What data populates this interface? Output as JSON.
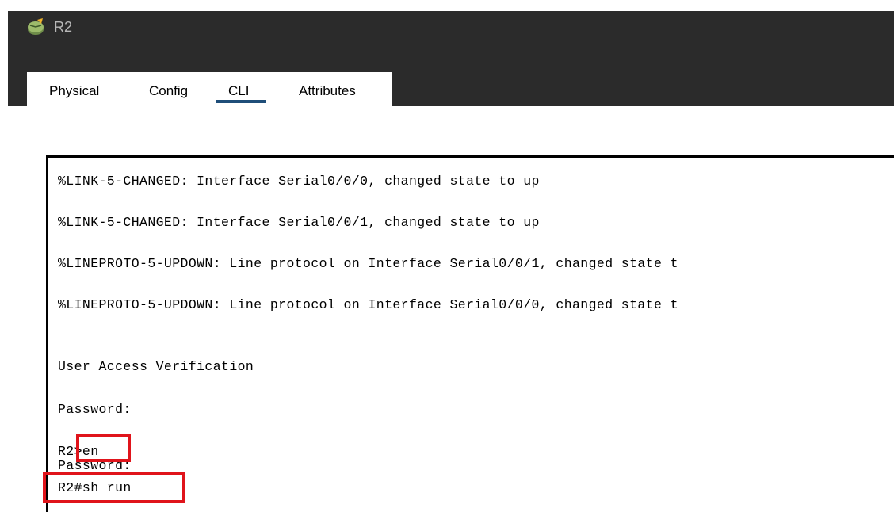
{
  "window": {
    "title": "R2",
    "icon": "router-device-icon"
  },
  "tabs": [
    {
      "label": "Physical"
    },
    {
      "label": "Config"
    },
    {
      "label": "CLI",
      "active": true
    },
    {
      "label": "Attributes"
    }
  ],
  "terminal": {
    "lines": [
      "%LINK-5-CHANGED: Interface Serial0/0/0, changed state to up",
      "%LINK-5-CHANGED: Interface Serial0/0/1, changed state to up",
      "%LINEPROTO-5-UPDOWN: Line protocol on Interface Serial0/0/1, changed state t",
      "%LINEPROTO-5-UPDOWN: Line protocol on Interface Serial0/0/0, changed state t",
      "User Access Verification",
      "Password:",
      "R2>en",
      "Password:",
      "R2#sh run"
    ]
  },
  "colors": {
    "titlebar": "#2b2b2b",
    "tab_underline": "#1f4e79",
    "highlight": "#e0141b"
  }
}
